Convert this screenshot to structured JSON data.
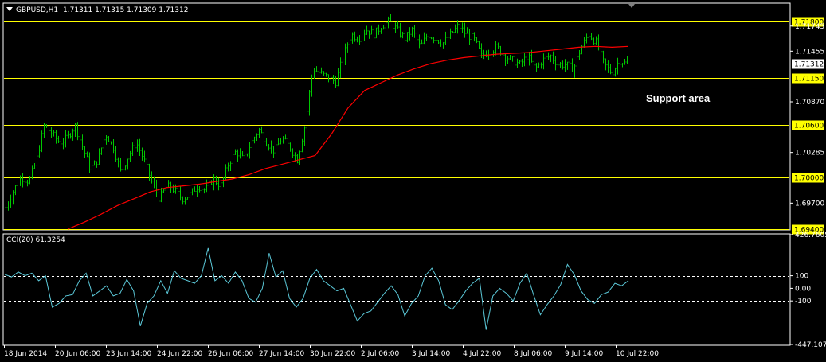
{
  "header": {
    "symbol_label": "GBPUSD,H1",
    "ohlc": "1.71311 1.71315 1.71309 1.71312",
    "indicator_label": "CCI(20) 61.3254"
  },
  "colors": {
    "background": "#000000",
    "frame": "#ffffff",
    "bull_bars": "#00c800",
    "moving_average": "#ff0000",
    "level_lines": "#ffff00",
    "level_label_bg": "#ffff00",
    "price_line": "#a0a0a0",
    "cci_line": "#5bc8d8",
    "cci_levels": "#ffffff"
  },
  "chart_data": [
    {
      "type": "line",
      "title": "GBPUSD,H1",
      "price_range": [
        1.694,
        1.72
      ],
      "price_axis_ticks": [
        "1.71745",
        "1.71455",
        "1.70870",
        "1.70285",
        "1.69700"
      ],
      "horizontal_levels": [
        {
          "value": 1.718,
          "label": "1.71800"
        },
        {
          "value": 1.7115,
          "label": "1.71150"
        },
        {
          "value": 1.706,
          "label": "1.70600"
        },
        {
          "value": 1.7,
          "label": "1.70000"
        },
        {
          "value": 1.694,
          "label": "1.69400"
        }
      ],
      "current_price": {
        "value": 1.71312,
        "label": "1.71312"
      },
      "annotation": "Support area",
      "x_axis_labels": [
        "18 Jun 2014",
        "20 Jun 06:00",
        "23 Jun 14:00",
        "24 Jun 22:00",
        "26 Jun 06:00",
        "27 Jun 14:00",
        "30 Jun 22:00",
        "2 Jul 06:00",
        "3 Jul 14:00",
        "4 Jul 22:00",
        "8 Jul 06:00",
        "9 Jul 14:00",
        "10 Jul 22:00"
      ],
      "price_series": [
        1.6965,
        1.6985,
        1.7,
        1.6995,
        1.702,
        1.706,
        1.705,
        1.704,
        1.7045,
        1.706,
        1.7035,
        1.701,
        1.702,
        1.705,
        1.7035,
        1.7005,
        1.7025,
        1.704,
        1.702,
        1.6995,
        1.6975,
        1.699,
        1.6985,
        1.6975,
        1.698,
        1.699,
        1.6985,
        1.6998,
        1.699,
        1.7015,
        1.703,
        1.702,
        1.704,
        1.7055,
        1.704,
        1.703,
        1.7045,
        1.7035,
        1.702,
        1.706,
        1.7125,
        1.712,
        1.7115,
        1.711,
        1.714,
        1.7165,
        1.716,
        1.717,
        1.7165,
        1.7175,
        1.718,
        1.717,
        1.716,
        1.717,
        1.715,
        1.7165,
        1.716,
        1.7155,
        1.7165,
        1.7175,
        1.7165,
        1.716,
        1.714,
        1.7145,
        1.715,
        1.714,
        1.7135,
        1.713,
        1.714,
        1.7125,
        1.7135,
        1.714,
        1.713,
        1.713,
        1.7125,
        1.715,
        1.7165,
        1.7155,
        1.713,
        1.712,
        1.7135,
        1.713
      ],
      "ma_series": [
        1.694,
        1.6948,
        1.6957,
        1.6967,
        1.6975,
        1.6983,
        1.6988,
        1.699,
        1.6992,
        1.6995,
        1.6998,
        1.7003,
        1.701,
        1.7015,
        1.702,
        1.7025,
        1.705,
        1.708,
        1.71,
        1.7109,
        1.7118,
        1.7125,
        1.7131,
        1.7135,
        1.7138,
        1.714,
        1.7142,
        1.7143,
        1.7144,
        1.7146,
        1.7148,
        1.715,
        1.7151,
        1.715,
        1.7151
      ],
      "series": []
    },
    {
      "type": "line",
      "title": "CCI(20) 61.3254",
      "y_range": [
        -447.1073,
        426.7605
      ],
      "y_axis_ticks": [
        "426.7605",
        "100",
        "0.00",
        "-100",
        "-447.1073"
      ],
      "levels": [
        100,
        -100
      ],
      "series": [],
      "values": [
        110,
        90,
        130,
        100,
        120,
        60,
        100,
        -150,
        -120,
        -60,
        -50,
        60,
        120,
        -60,
        -20,
        20,
        -60,
        -40,
        70,
        -20,
        -300,
        -120,
        -60,
        60,
        -40,
        140,
        80,
        60,
        40,
        100,
        320,
        60,
        100,
        40,
        130,
        60,
        -80,
        -110,
        0,
        280,
        90,
        140,
        -80,
        -150,
        -80,
        80,
        150,
        60,
        20,
        -20,
        0,
        -130,
        -260,
        -200,
        -180,
        -110,
        -40,
        20,
        -50,
        -220,
        -120,
        -60,
        100,
        160,
        60,
        -130,
        -170,
        -100,
        -20,
        40,
        80,
        -330,
        -60,
        0,
        -40,
        -100,
        40,
        120,
        -50,
        -210,
        -130,
        -60,
        30,
        190,
        110,
        -20,
        -90,
        -120,
        -50,
        -30,
        40,
        20,
        61
      ]
    }
  ]
}
